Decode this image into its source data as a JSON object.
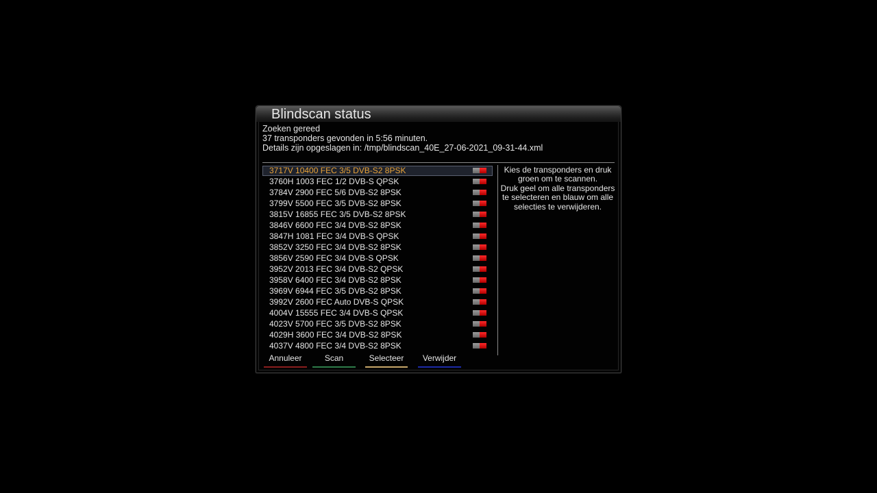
{
  "dialog": {
    "title": "Blindscan status",
    "status_lines": [
      "Zoeken gereed",
      "37 transponders gevonden in 5:56 minuten.",
      "Details zijn opgeslagen in: /tmp/blindscan_40E_27-06-2021_09-31-44.xml"
    ]
  },
  "transponders": [
    "3717V 10400 FEC 3/5 DVB-S2 8PSK",
    "3760H 1003 FEC 1/2 DVB-S QPSK",
    "3784V 2900 FEC 5/6 DVB-S2 8PSK",
    "3799V 5500 FEC 3/5 DVB-S2 8PSK",
    "3815V 16855 FEC 3/5 DVB-S2 8PSK",
    "3846V 6600 FEC 3/4 DVB-S2 8PSK",
    "3847H 1081 FEC 3/4 DVB-S QPSK",
    "3852V 3250 FEC 3/4 DVB-S2 8PSK",
    "3856V 2590 FEC 3/4 DVB-S QPSK",
    "3952V 2013 FEC 3/4 DVB-S2 QPSK",
    "3958V 6400 FEC 3/4 DVB-S2 8PSK",
    "3969V 6944 FEC 3/5 DVB-S2 8PSK",
    "3992V 2600 FEC Auto DVB-S QPSK",
    "4004V 15555 FEC 3/4 DVB-S QPSK",
    "4023V 5700 FEC 3/5 DVB-S2 8PSK",
    "4029H 3600 FEC 3/4 DVB-S2 8PSK",
    "4037V 4800 FEC 3/4 DVB-S2 8PSK"
  ],
  "selected_index": 0,
  "help_lines": [
    "Kies de transponders en druk",
    "groen om te scannen.",
    "Druk geel om alle transponders",
    "te selecteren en blauw om alle",
    "selecties te verwijderen."
  ],
  "buttons": {
    "red": {
      "label": "Annuleer",
      "color": "#8b1e1e"
    },
    "green": {
      "label": "Scan",
      "color": "#2e7d4a"
    },
    "yellow": {
      "label": "Selecteer",
      "color": "#c8a86a"
    },
    "blue": {
      "label": "Verwijder",
      "color": "#1c2aa8"
    }
  },
  "colors": {
    "selected_text": "#e8a33a",
    "text": "#e6e6e6",
    "flag_off": "#8a8a8a",
    "flag_red": "#e01010"
  }
}
